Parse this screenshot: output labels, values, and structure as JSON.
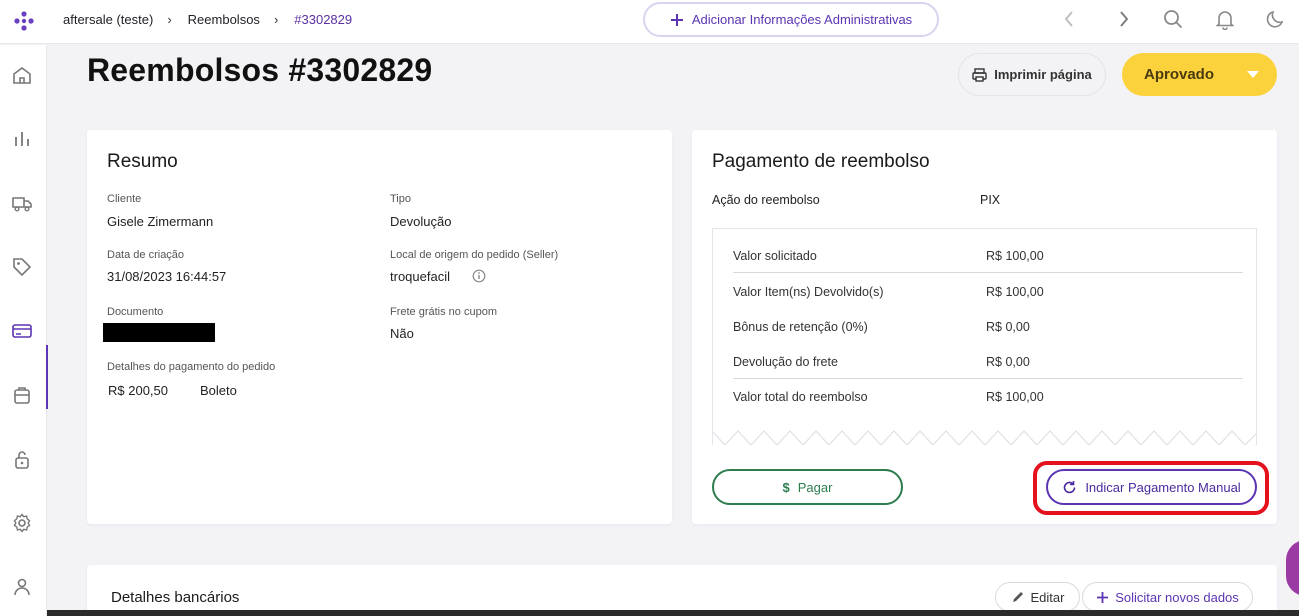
{
  "breadcrumb": {
    "store": "aftersale (teste)",
    "section": "Reembolsos",
    "current": "#3302829"
  },
  "header_actions": {
    "admin_label": "Adicionar Informações Administrativas"
  },
  "page": {
    "title": "Reembolsos #3302829",
    "print_label": "Imprimir página",
    "status_label": "Aprovado",
    "status_color": "#fbd13c"
  },
  "resumo": {
    "title": "Resumo",
    "cliente_label": "Cliente",
    "cliente_value": "Gisele Zimermann",
    "tipo_label": "Tipo",
    "tipo_value": "Devolução",
    "data_label": "Data de criação",
    "data_value": "31/08/2023 16:44:57",
    "origem_label": "Local de origem do pedido (Seller)",
    "origem_value": "troquefacil",
    "documento_label": "Documento",
    "frete_label": "Frete grátis no cupom",
    "frete_value": "Não",
    "pagamento_label": "Detalhes do pagamento do pedido",
    "pagamento_valor": "R$ 200,50",
    "pagamento_metodo": "Boleto"
  },
  "pagamento": {
    "title": "Pagamento de reembolso",
    "acao_label": "Ação do reembolso",
    "acao_value": "PIX",
    "rows": [
      {
        "label": "Valor solicitado",
        "value": "R$ 100,00"
      },
      {
        "label": "Valor Item(ns) Devolvido(s)",
        "value": "R$ 100,00"
      },
      {
        "label": "Bônus de retenção (0%)",
        "value": "R$ 0,00"
      },
      {
        "label": "Devolução do frete",
        "value": "R$ 0,00"
      },
      {
        "label": "Valor total do reembolso",
        "value": "R$ 100,00"
      }
    ],
    "pagar_label": "Pagar",
    "manual_label": "Indicar Pagamento Manual"
  },
  "bancarios": {
    "title": "Detalhes bancários",
    "editar_label": "Editar",
    "solicitar_label": "Solicitar novos dados"
  },
  "icons": {
    "logo": "logo-icon",
    "back": "chevron-left-icon",
    "forward": "chevron-right-icon",
    "search": "search-icon",
    "bell": "bell-icon",
    "theme": "moon-icon",
    "sidebar": [
      "home-icon",
      "chart-icon",
      "truck-icon",
      "tag-icon",
      "card-icon",
      "box-icon",
      "lock-icon",
      "gear-icon",
      "user-icon"
    ]
  },
  "colors": {
    "primary": "#5b35b3",
    "success": "#2e7d4f",
    "highlight": "#e3121d"
  }
}
